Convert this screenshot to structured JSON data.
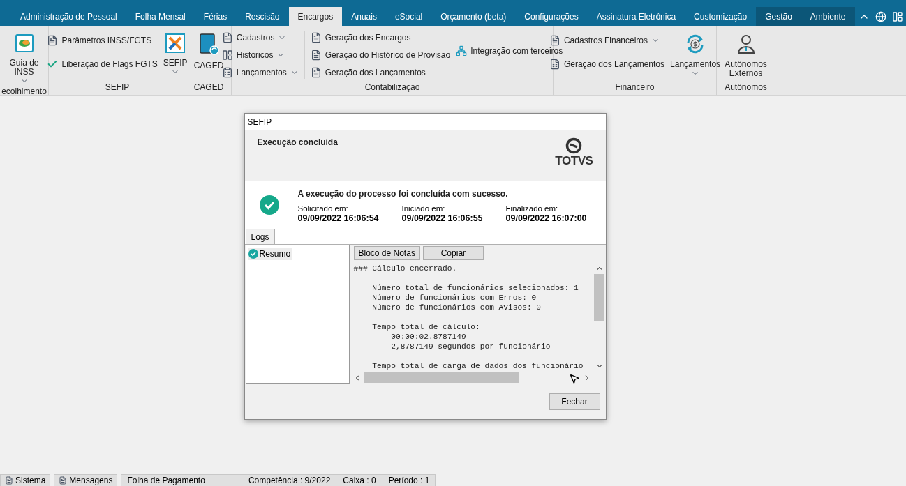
{
  "tabs": [
    {
      "label": "Administração de Pessoal",
      "selected": false,
      "contextual": false
    },
    {
      "label": "Folha Mensal",
      "selected": false,
      "contextual": false
    },
    {
      "label": "Férias",
      "selected": false,
      "contextual": false
    },
    {
      "label": "Rescisão",
      "selected": false,
      "contextual": false
    },
    {
      "label": "Encargos",
      "selected": true,
      "contextual": false
    },
    {
      "label": "Anuais",
      "selected": false,
      "contextual": false
    },
    {
      "label": "eSocial",
      "selected": false,
      "contextual": false
    },
    {
      "label": "Orçamento (beta)",
      "selected": false,
      "contextual": false
    },
    {
      "label": "Configurações",
      "selected": false,
      "contextual": false
    },
    {
      "label": "Assinatura Eletrônica",
      "selected": false,
      "contextual": false
    },
    {
      "label": "Customização",
      "selected": false,
      "contextual": false
    },
    {
      "label": "Gestão",
      "selected": false,
      "contextual": true
    },
    {
      "label": "Ambiente",
      "selected": false,
      "contextual": true
    }
  ],
  "ribbon": [
    {
      "label": "ecolhimento",
      "columns": [
        {
          "kind": "large",
          "label": "Guia de INSS",
          "dropdown": true
        }
      ]
    },
    {
      "label": "SEFIP",
      "columns": [
        {
          "kind": "small",
          "items": [
            {
              "label": "Parâmetros INSS/FGTS",
              "dropdown": false
            },
            {
              "label": "Liberação de Flags FGTS",
              "dropdown": false
            }
          ]
        },
        {
          "kind": "large",
          "label": "SEFIP",
          "dropdown": true
        }
      ]
    },
    {
      "label": "CAGED",
      "columns": [
        {
          "kind": "large",
          "label": "CAGED",
          "dropdown": false
        }
      ]
    },
    {
      "label": "Contabilização",
      "columns": [
        {
          "kind": "small",
          "items": [
            {
              "label": "Cadastros",
              "dropdown": true
            },
            {
              "label": "Históricos",
              "dropdown": true
            },
            {
              "label": "Lançamentos",
              "dropdown": true
            }
          ]
        },
        {
          "kind": "small",
          "items": [
            {
              "label": "Geração dos Encargos",
              "dropdown": false
            },
            {
              "label": "Geração do Histórico de Provisão",
              "dropdown": false
            },
            {
              "label": "Geração dos Lançamentos",
              "dropdown": false
            }
          ]
        },
        {
          "kind": "small",
          "items": [
            {
              "label": "Integração com terceiros",
              "dropdown": false
            }
          ]
        }
      ]
    },
    {
      "label": "Financeiro",
      "columns": [
        {
          "kind": "small",
          "items": [
            {
              "label": "Cadastros Financeiros",
              "dropdown": true
            },
            {
              "label": "Geração dos Lançamentos",
              "dropdown": false
            }
          ]
        },
        {
          "kind": "large",
          "label": "Lançamentos",
          "dropdown": true
        }
      ]
    },
    {
      "label": "Autônomos",
      "columns": [
        {
          "kind": "large",
          "label": "Autônomos Externos",
          "dropdown": false
        }
      ]
    }
  ],
  "dialog": {
    "title": "SEFIP",
    "header": "Execução concluída",
    "logo": "TOTVS",
    "message": "A execução do processo foi concluída com sucesso.",
    "stamps": [
      {
        "label": "Solicitado em:",
        "value": "09/09/2022 16:06:54"
      },
      {
        "label": "Iniciado em:",
        "value": "09/09/2022 16:06:55"
      },
      {
        "label": "Finalizado em:",
        "value": "09/09/2022 16:07:00"
      }
    ],
    "tabs": [
      {
        "label": "Logs",
        "selected": true
      }
    ],
    "tree": [
      {
        "label": "Resumo",
        "selected": true
      }
    ],
    "log_buttons": [
      "Bloco de Notas",
      "Copiar"
    ],
    "log_paragraphs": [
      [
        "### Cálculo encerrado."
      ],
      [
        "    Número total de funcionários selecionados: 1",
        "    Número de funcionários com Erros: 0",
        "    Número de funcionários com Avisos: 0"
      ],
      [
        "    Tempo total de cálculo:",
        "        00:00:02.8787149",
        "        2,8787149 segundos por funcionário"
      ],
      [
        "    Tempo total de carga de dados dos funcionário"
      ]
    ],
    "close_button": "Fechar"
  },
  "status_bar": [
    {
      "kind": "tab",
      "label": "Sistema"
    },
    {
      "kind": "tab",
      "label": "Mensagens"
    },
    {
      "kind": "info",
      "fields": [
        "Folha de Pagamento",
        "Competência : 9/2022",
        "Caixa : 0",
        "Período : 1"
      ]
    }
  ]
}
